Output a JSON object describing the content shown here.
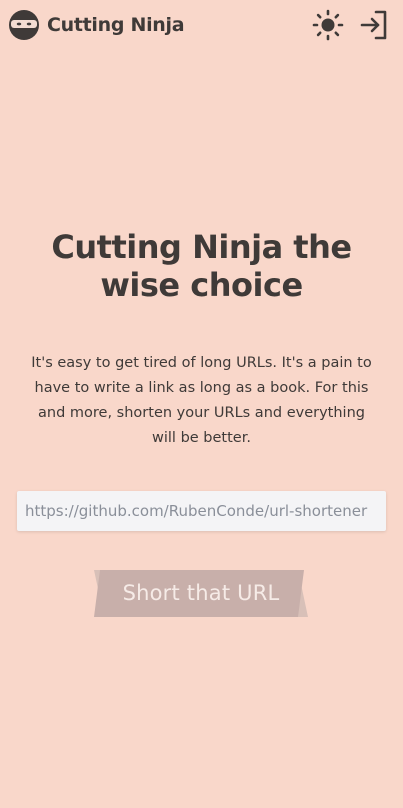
{
  "header": {
    "brand_name": "Cutting Ninja",
    "logo_icon": "ninja-logo-icon",
    "theme_toggle_icon": "sun-icon",
    "login_icon": "login-icon"
  },
  "hero": {
    "title": "Cutting Ninja the wise choice",
    "description": "It's easy to get tired of long URLs. It's a pain to have to write a link as long as a book. For this and more, shorten your URLs and everything will be better."
  },
  "form": {
    "url_value": "https://github.com/RubenConde/url-shortener",
    "submit_label": "Short that URL"
  },
  "colors": {
    "background": "#f9d7ca",
    "text": "#3f3a38",
    "input_bg": "#f4f4f6",
    "button_fill": "#c8afaa",
    "button_shadow": "#d8c0b8"
  }
}
